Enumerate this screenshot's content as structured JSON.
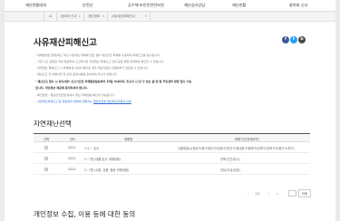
{
  "topnav": {
    "items": [
      "재난현황대처",
      "안전신",
      "공수해·보안안전안보원",
      "재난심리상담",
      "재난현황",
      "참여와 신고"
    ]
  },
  "breadcrumb": {
    "items": [
      "참여와 신고",
      "개인정보",
      "사유재산피해신고"
    ]
  },
  "page": {
    "title": "사유재산피해신고"
  },
  "share": [
    {
      "label": "f",
      "color": "#3b5998",
      "icon": "facebook-icon"
    },
    {
      "label": "t",
      "color": "#1da1f2",
      "icon": "twitter-icon"
    },
    {
      "label": "b",
      "color": "#4a4a4a",
      "icon": "blog-icon"
    }
  ],
  "notice": {
    "lines": [
      "- 피해발생일 현재(최근 3년) 사유재산 피해를 입은 경우 재난안전 피해를 수용하여 피해신고를 접수합니다.",
      "- 기존 신고·감면된 작성 방문하여 신고하시면 자연재난 피해신고 관련 공동 현재 검색하여 확인할 수 있습니다.",
      "- 자연재난 재해신고 시 피해발생 사실이 확인된 경우 재난지원금 지원여부가 검토될 수 있습니다.",
      "- 재난신고 전 피해사진 및 관련 증빙서류를 준비하여 주시기 바랍니다."
    ],
    "bold_line_1": "- 재난신고 접수 시 유의사항: 신고기간은 피해발생일로부터 10일 이내이며, 주소지 시·군·구 또는 읍·면·동 주민센터 방문 접수 가능",
    "bold_line_2": "입니다. 개인정보 제공에 동의하셔야 합니다.",
    "blue_line_1": "- 확인방법 : 재난안전포털 등에서 재난 피해상황 확인이 가능합니다.",
    "blue_prefix": "- 사유재산피해신고 등 행정처리 방법에 대해서는",
    "blue_link": "행정안전부 재난복구지원과 안내"
  },
  "table": {
    "heading": "자연재난선택",
    "columns": [
      "선택",
      "년도",
      "재해명",
      "피해기간(피해지역)"
    ],
    "rows": [
      {
        "year": "2024",
        "name": "7.4 ~ 호우",
        "region": "서울특별시(종로구/중구/용산구/성동구/광진구/동대문구/중랑구/성북구/강북구/도봉구/노원구)"
      },
      {
        "year": "2024",
        "name": "2~7월 (태풍/호우 피해현황)",
        "region": "전북(진안/장수)"
      },
      {
        "year": "2024",
        "name": "2~7월 (교통, 강풍, 풍랑 피해현황)",
        "region": "전남(보성/영광)"
      }
    ]
  },
  "pager": {
    "prev": "‹",
    "info": "1/1",
    "next": "›",
    "last": "»",
    "go": "이동"
  },
  "consent": {
    "heading": "개인정보 수집, 이용 등에 대한 동의"
  }
}
